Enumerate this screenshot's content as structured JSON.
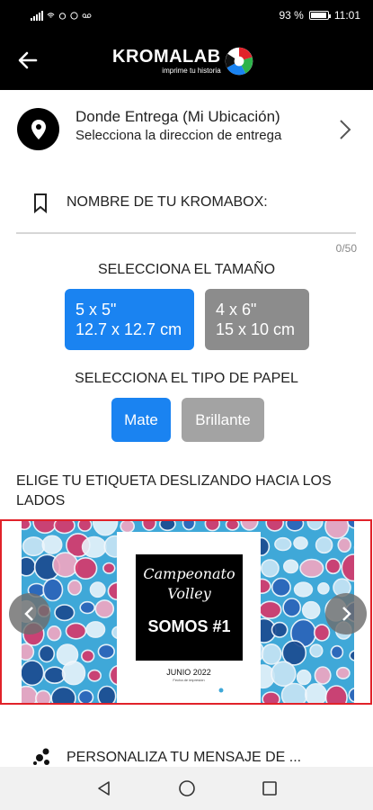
{
  "status_bar": {
    "battery": "93 %",
    "time": "11:01",
    "battery_level": 0.93
  },
  "header": {
    "back_icon": "arrow-left-icon",
    "logo_word": "KROMALAB",
    "logo_tagline": "imprime tu historia",
    "logo_colors": [
      "#e1222a",
      "#2db34a",
      "#1a83f1",
      "#ffffff"
    ]
  },
  "location": {
    "icon": "location-pin-icon",
    "title": "Donde Entrega (Mi Ubicación)",
    "subtitle": "Selecciona la direccion de entrega",
    "chevron_icon": "chevron-right-icon"
  },
  "name_field": {
    "icon": "bookmark-icon",
    "label": "NOMBRE DE TU KROMABOX:",
    "counter": "0/50"
  },
  "size": {
    "heading": "SELECCIONA EL TAMAÑO",
    "options": [
      {
        "line1": "5 x 5\"",
        "line2": "12.7 x 12.7 cm",
        "selected": true
      },
      {
        "line1": "4 x 6\"",
        "line2": "15 x 10 cm",
        "selected": false
      }
    ]
  },
  "paper": {
    "heading": "SELECCIONA EL TIPO DE PAPEL",
    "options": [
      {
        "label": "Mate",
        "selected": true
      },
      {
        "label": "Brillante",
        "selected": false
      }
    ]
  },
  "label_picker": {
    "heading": "ELIGE TU ETIQUETA DESLIZANDO HACIA LOS LADOS",
    "card": {
      "script_line1": "Campeonato",
      "script_line2": "Volley",
      "main_text": "SOMOS #1",
      "date": "JUNIO 2022",
      "date_caption": "Fecha de impresión",
      "brand": "KROMALAB"
    },
    "prev_icon": "chevron-left-icon",
    "next_icon": "chevron-right-icon"
  },
  "personalize": {
    "icon": "dots-icon",
    "label": "PERSONALIZA TU MENSAJE DE ..."
  },
  "colors": {
    "accent": "#1a83f1",
    "unselected": "#8c8c8c",
    "carousel_border": "#e1222a",
    "header_bg": "#000000"
  },
  "nav_bar": {
    "back": "triangle-back-icon",
    "home": "circle-home-icon",
    "recents": "square-recents-icon"
  }
}
